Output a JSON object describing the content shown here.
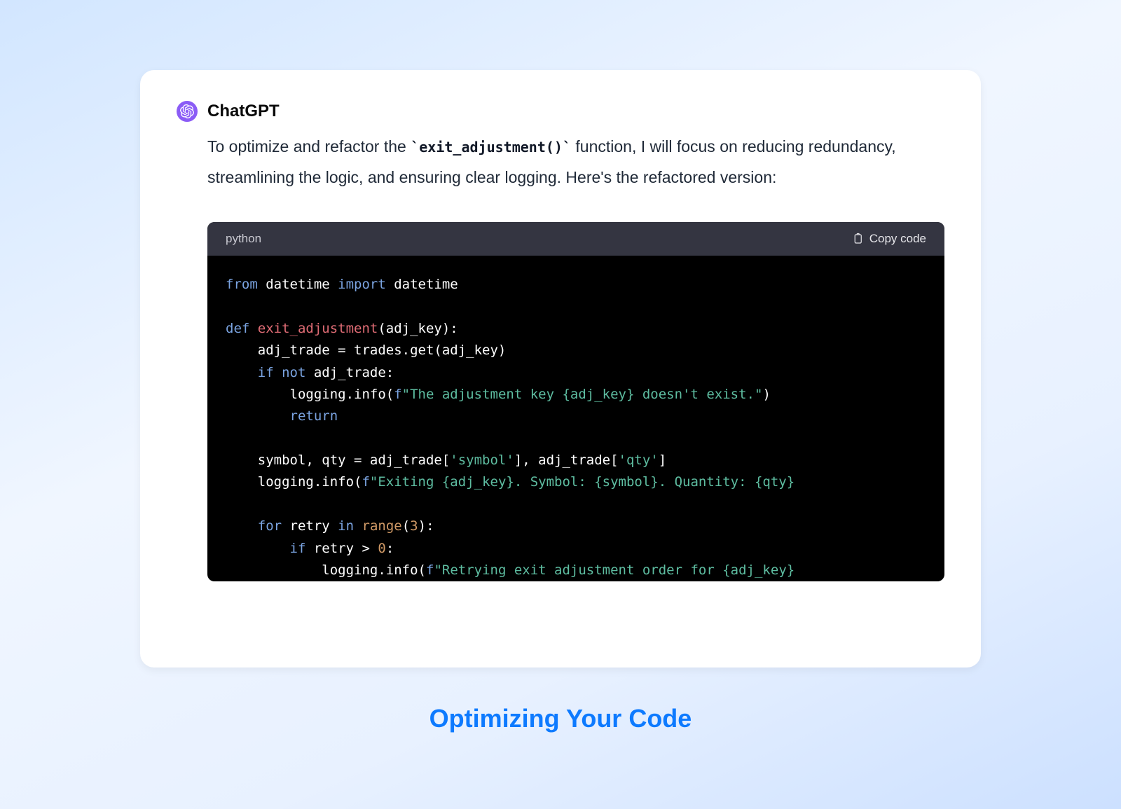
{
  "bot_name": "ChatGPT",
  "message_pre": "To optimize and refactor the ",
  "inline_code": "`exit_adjustment()`",
  "message_post": " function, I will focus on reducing redundancy, streamlining the logic, and ensuring clear logging. Here's the refactored version:",
  "code": {
    "language": "python",
    "copy_label": "Copy code",
    "tokens": [
      {
        "c": "tk-kw",
        "t": "from"
      },
      {
        "c": "tk-mod",
        "t": " datetime "
      },
      {
        "c": "tk-kw",
        "t": "import"
      },
      {
        "c": "tk-mod",
        "t": " datetime"
      },
      {
        "br": 2
      },
      {
        "c": "tk-kw",
        "t": "def "
      },
      {
        "c": "tk-fn",
        "t": "exit_adjustment"
      },
      {
        "c": "tk-var",
        "t": "(adj_key):"
      },
      {
        "br": 1
      },
      {
        "c": "tk-var",
        "t": "    adj_trade = trades.get(adj_key)"
      },
      {
        "br": 1
      },
      {
        "c": "tk-var",
        "t": "    "
      },
      {
        "c": "tk-kw",
        "t": "if not"
      },
      {
        "c": "tk-var",
        "t": " adj_trade:"
      },
      {
        "br": 1
      },
      {
        "c": "tk-var",
        "t": "        logging.info("
      },
      {
        "c": "tk-kw",
        "t": "f"
      },
      {
        "c": "tk-str",
        "t": "\"The adjustment key {adj_key} doesn't exist.\""
      },
      {
        "c": "tk-var",
        "t": ")"
      },
      {
        "br": 1
      },
      {
        "c": "tk-var",
        "t": "        "
      },
      {
        "c": "tk-kw",
        "t": "return"
      },
      {
        "br": 2
      },
      {
        "c": "tk-var",
        "t": "    symbol, qty = adj_trade["
      },
      {
        "c": "tk-str",
        "t": "'symbol'"
      },
      {
        "c": "tk-var",
        "t": "], adj_trade["
      },
      {
        "c": "tk-str",
        "t": "'qty'"
      },
      {
        "c": "tk-var",
        "t": "]"
      },
      {
        "br": 1
      },
      {
        "c": "tk-var",
        "t": "    logging.info("
      },
      {
        "c": "tk-kw",
        "t": "f"
      },
      {
        "c": "tk-str",
        "t": "\"Exiting {adj_key}. Symbol: {symbol}. Quantity: {qty}"
      },
      {
        "br": 2
      },
      {
        "c": "tk-var",
        "t": "    "
      },
      {
        "c": "tk-kw",
        "t": "for"
      },
      {
        "c": "tk-var",
        "t": " retry "
      },
      {
        "c": "tk-kw",
        "t": "in"
      },
      {
        "c": "tk-var",
        "t": " "
      },
      {
        "c": "tk-num",
        "t": "range"
      },
      {
        "c": "tk-var",
        "t": "("
      },
      {
        "c": "tk-num",
        "t": "3"
      },
      {
        "c": "tk-var",
        "t": "):"
      },
      {
        "br": 1
      },
      {
        "c": "tk-var",
        "t": "        "
      },
      {
        "c": "tk-kw",
        "t": "if"
      },
      {
        "c": "tk-var",
        "t": " retry > "
      },
      {
        "c": "tk-num",
        "t": "0"
      },
      {
        "c": "tk-var",
        "t": ":"
      },
      {
        "br": 1
      },
      {
        "c": "tk-var",
        "t": "            logging.info("
      },
      {
        "c": "tk-kw",
        "t": "f"
      },
      {
        "c": "tk-str",
        "t": "\"Retrying exit adjustment order for {adj_key}"
      }
    ]
  },
  "caption": "Optimizing Your Code"
}
